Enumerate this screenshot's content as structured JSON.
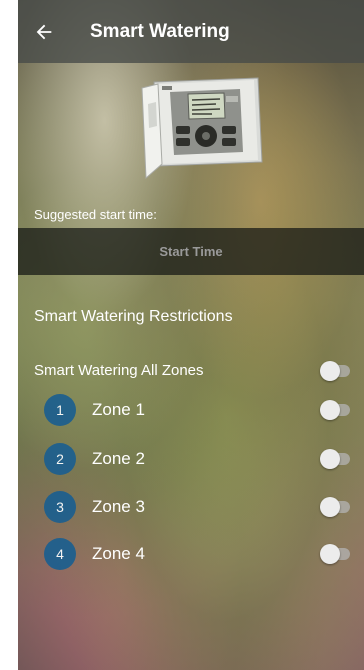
{
  "app_bar": {
    "title": "Smart Watering",
    "back_icon": "arrow-left-icon"
  },
  "device": {
    "image": "sprinkler-controller-image"
  },
  "schedule": {
    "suggested_label": "Suggested start time:",
    "start_time_button": "Start Time"
  },
  "restrictions": {
    "title": "Smart Watering Restrictions",
    "all_zones_label": "Smart Watering All Zones",
    "all_zones_on": false
  },
  "zones": [
    {
      "number": "1",
      "label": "Zone 1",
      "on": false
    },
    {
      "number": "2",
      "label": "Zone 2",
      "on": false
    },
    {
      "number": "3",
      "label": "Zone 3",
      "on": false
    },
    {
      "number": "4",
      "label": "Zone 4",
      "on": false
    }
  ],
  "colors": {
    "zone_badge": "#1c5f8f",
    "app_bar": "#464a48"
  }
}
